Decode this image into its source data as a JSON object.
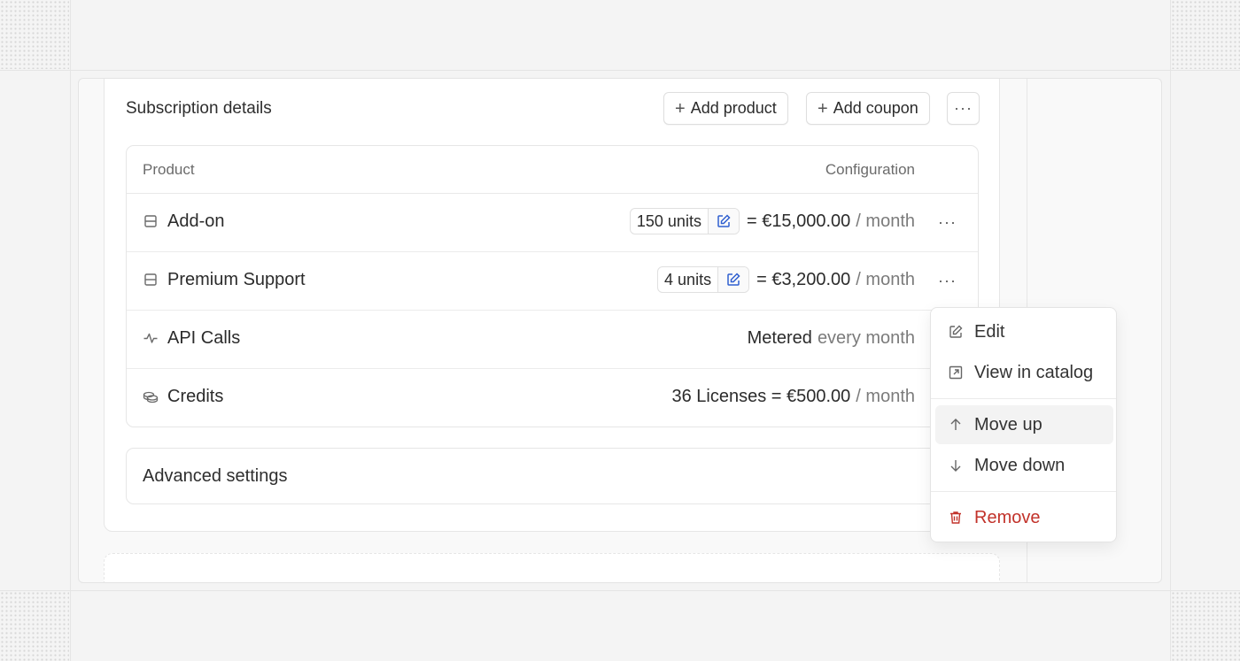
{
  "subscription": {
    "title": "Subscription details",
    "add_product_label": "Add product",
    "add_coupon_label": "Add coupon",
    "more_label": "···"
  },
  "table": {
    "headers": {
      "product": "Product",
      "configuration": "Configuration"
    },
    "rows": [
      {
        "name": "Add-on",
        "icon": "list-box-icon",
        "units": "150 units",
        "price": "= €15,000.00",
        "period": "/ month",
        "more": "···"
      },
      {
        "name": "Premium Support",
        "icon": "list-box-icon",
        "units": "4 units",
        "price": "= €3,200.00",
        "period": "/ month",
        "more": "···"
      },
      {
        "name": "API Calls",
        "icon": "activity-icon",
        "metered": "Metered",
        "frequency": "every month"
      },
      {
        "name": "Credits",
        "icon": "coins-icon",
        "price": "36 Licenses = €500.00",
        "period": "/ month"
      }
    ]
  },
  "advanced": {
    "title": "Advanced settings"
  },
  "menu": {
    "items": [
      {
        "label": "Edit",
        "icon": "edit-icon"
      },
      {
        "label": "View in catalog",
        "icon": "external-link-icon"
      },
      {
        "label": "Move up",
        "icon": "arrow-up-icon"
      },
      {
        "label": "Move down",
        "icon": "arrow-down-icon"
      },
      {
        "label": "Remove",
        "icon": "trash-icon"
      }
    ]
  },
  "colors": {
    "accent": "#2f5fd0",
    "danger": "#c2322a"
  }
}
